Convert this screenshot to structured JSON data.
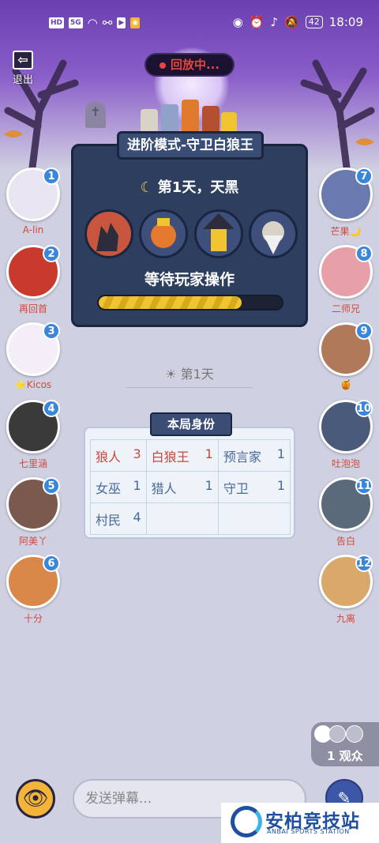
{
  "status_bar": {
    "left_icons": [
      "HD",
      "5G",
      "wifi",
      "link",
      "send",
      "app"
    ],
    "battery": "42",
    "time": "18:09"
  },
  "header": {
    "exit_label": "退出",
    "replay_label": "回放中..."
  },
  "game": {
    "mode_title": "进阶模式-守卫白狼王",
    "night_label": "第1天，天黑",
    "roles": [
      "werewolf-icon",
      "guard-icon",
      "witch-icon",
      "seer-icon"
    ],
    "waiting_label": "等待玩家操作",
    "progress": 0.78
  },
  "players_left": [
    {
      "num": "1",
      "name": "A-lin"
    },
    {
      "num": "2",
      "name": "再回首"
    },
    {
      "num": "3",
      "name": "⭐Kicos"
    },
    {
      "num": "4",
      "name": "七里涵"
    },
    {
      "num": "5",
      "name": "阿美丫"
    },
    {
      "num": "6",
      "name": "十分"
    }
  ],
  "players_right": [
    {
      "num": "7",
      "name": "芒果🌙"
    },
    {
      "num": "8",
      "name": "二师兄"
    },
    {
      "num": "9",
      "name": "🍯"
    },
    {
      "num": "10",
      "name": "吐泡泡"
    },
    {
      "num": "11",
      "name": "告白"
    },
    {
      "num": "12",
      "name": "九离"
    }
  ],
  "day_separator": "第1天",
  "identity": {
    "title": "本局身份",
    "rows": [
      [
        {
          "role": "狼人",
          "count": "3"
        },
        {
          "role": "白狼王",
          "count": "1"
        },
        {
          "role": "预言家",
          "count": "1"
        }
      ],
      [
        {
          "role": "女巫",
          "count": "1"
        },
        {
          "role": "猎人",
          "count": "1"
        },
        {
          "role": "守卫",
          "count": "1"
        }
      ],
      [
        {
          "role": "村民",
          "count": "4"
        },
        {
          "role": "",
          "count": ""
        },
        {
          "role": "",
          "count": ""
        }
      ]
    ]
  },
  "spectators": {
    "label": "1 观众"
  },
  "bottom": {
    "danmu_placeholder": "发送弹幕..."
  },
  "watermark": {
    "title": "安柏竞技站",
    "subtitle": "ANBAI SPORTS STATION"
  },
  "colors": {
    "accent_blue": "#3a86d8",
    "panel": "#2d3e5f",
    "wolf_red": "#c9463a",
    "progress": "#f0c531"
  }
}
